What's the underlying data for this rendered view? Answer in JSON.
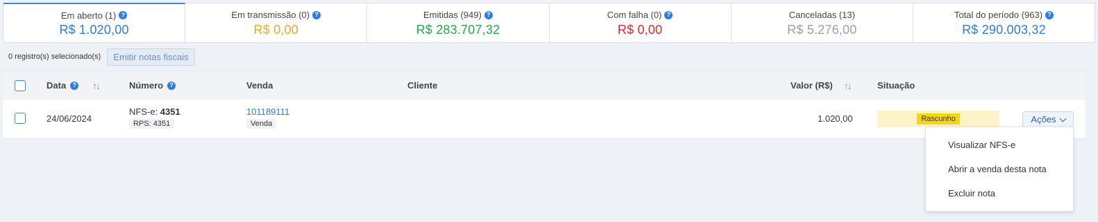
{
  "summary_tabs": [
    {
      "label": "Em aberto (1)",
      "value": "R$ 1.020,00",
      "color": "#2b7de0",
      "help": true
    },
    {
      "label": "Em transmissão (0)",
      "value": "R$ 0,00",
      "color": "#f5a623",
      "help": true
    },
    {
      "label": "Emitidas (949)",
      "value": "R$ 283.707,32",
      "color": "#21a84a",
      "help": true
    },
    {
      "label": "Com falha (0)",
      "value": "R$ 0,00",
      "color": "#e8252c",
      "help": true
    },
    {
      "label": "Canceladas (13)",
      "value": "R$ 5.276,00",
      "color": "#9aa0a6",
      "help": false
    },
    {
      "label": "Total do período (963)",
      "value": "R$ 290.003,32",
      "color": "#2b7de0",
      "help": true
    }
  ],
  "selection": {
    "count_text": "0 registro(s) selecionado(s)",
    "emit_button": "Emitir notas fiscais"
  },
  "table": {
    "headers": {
      "date": "Data",
      "number": "Número",
      "sale": "Venda",
      "client": "Cliente",
      "value": "Valor (R$)",
      "status": "Situação"
    },
    "rows": [
      {
        "date": "24/06/2024",
        "number_prefix": "NFS-e: ",
        "number": "4351",
        "rps": "RPS: 4351",
        "sale_id": "101189111",
        "sale_type": "Venda",
        "client": "",
        "value": "1.020,00",
        "status": "Rascunho",
        "actions": "Ações"
      }
    ]
  },
  "actions_menu": {
    "items": [
      "Visualizar NFS-e",
      "Abrir a venda desta nota",
      "Excluir nota"
    ]
  }
}
